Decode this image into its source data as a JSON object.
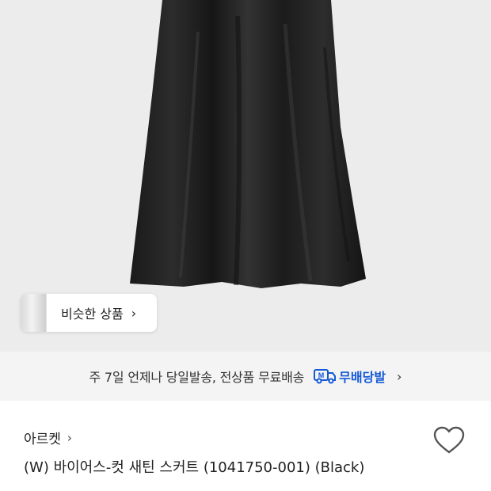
{
  "similar": {
    "label": "비슷한 상품",
    "chevron": "›"
  },
  "shipping": {
    "text": "주 7일 언제나 당일발송, 전상품 무료배송",
    "badge_letter": "M",
    "badge_label": "무배당발",
    "chevron": "›",
    "accent": "#1459d6"
  },
  "product": {
    "brand": "아르켓",
    "brand_chevron": "›",
    "title": "(W) 바이어스-컷 새틴 스커트 (1041750-001) (Black)"
  },
  "icons": {
    "wish": "heart-icon",
    "ship": "truck-icon"
  }
}
